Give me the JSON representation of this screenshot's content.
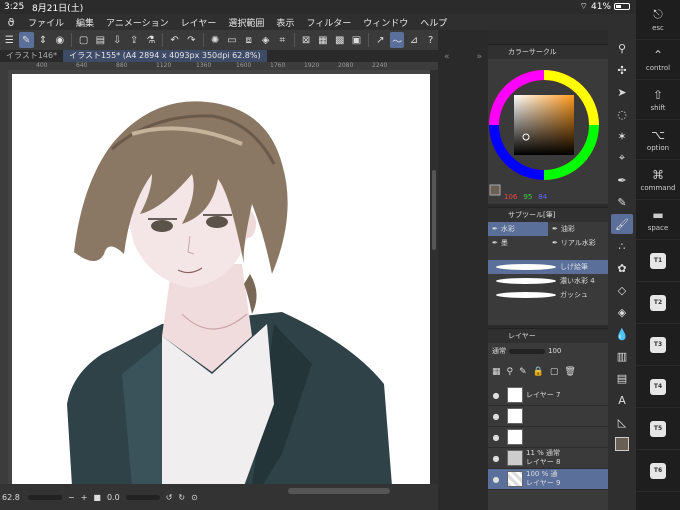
{
  "status_bar": {
    "time": "3:25",
    "date": "8月21日(土)",
    "battery": "41%",
    "battery_level": 0.41
  },
  "menu": {
    "items": [
      "ファイル",
      "編集",
      "アニメーション",
      "レイヤー",
      "選択範囲",
      "表示",
      "フィルター",
      "ウィンドウ",
      "ヘルプ"
    ]
  },
  "tabs": [
    {
      "label": "イラスト146*",
      "active": false
    },
    {
      "label": "イラスト155* (A4 2894 x 4093px 350dpi 62.8%)",
      "active": true
    }
  ],
  "ruler": {
    "ticks": [
      "400",
      "640",
      "880",
      "1120",
      "1360",
      "1600",
      "1760",
      "1920",
      "2080",
      "2240"
    ]
  },
  "bottom_bar": {
    "zoom": "62.8",
    "rotation": "0.0"
  },
  "color_panel": {
    "title": "カラーサークル",
    "r": "106",
    "g": "95",
    "b": "84",
    "accent": "#6a5f54"
  },
  "sub_tool": {
    "title": "サブツール[筆]",
    "buttons": [
      "水彩",
      "油彩",
      "墨",
      "リアル水彩"
    ],
    "brushes": [
      {
        "name": "しげ絵筆",
        "selected": true
      },
      {
        "name": "濃い水彩 4",
        "selected": false
      },
      {
        "name": "ガッシュ",
        "selected": false
      }
    ]
  },
  "layer_panel": {
    "title": "レイヤー",
    "blend_mode": "通常",
    "opacity": "100",
    "layers": [
      {
        "name": "レイヤー 7",
        "info": ""
      },
      {
        "name": "",
        "info": ""
      },
      {
        "name": "",
        "info": ""
      },
      {
        "name": "レイヤー 8",
        "info": "11 % 通常"
      },
      {
        "name": "レイヤー 9",
        "info": "100 % 通"
      }
    ]
  },
  "keys": [
    {
      "glyph": "⎋",
      "label": "esc"
    },
    {
      "glyph": "⌃",
      "label": "control"
    },
    {
      "glyph": "⇧",
      "label": "shift"
    },
    {
      "glyph": "⌥",
      "label": "option"
    },
    {
      "glyph": "⌘",
      "label": "command"
    },
    {
      "glyph": "▬",
      "label": "space"
    }
  ],
  "quick_keys": [
    "T1",
    "T2",
    "T3",
    "T4",
    "T5",
    "T6"
  ],
  "tools": [
    "zoom-icon",
    "move-icon",
    "operation-icon",
    "lasso-icon",
    "wand-icon",
    "eyedropper-icon",
    "pen-icon",
    "pencil-icon",
    "brush-icon",
    "airbrush-icon",
    "decoration-icon",
    "eraser-icon",
    "fill-icon",
    "blend-icon",
    "gradient-icon",
    "frame-icon",
    "text-icon",
    "ruler-icon",
    "color-swatch-icon"
  ]
}
